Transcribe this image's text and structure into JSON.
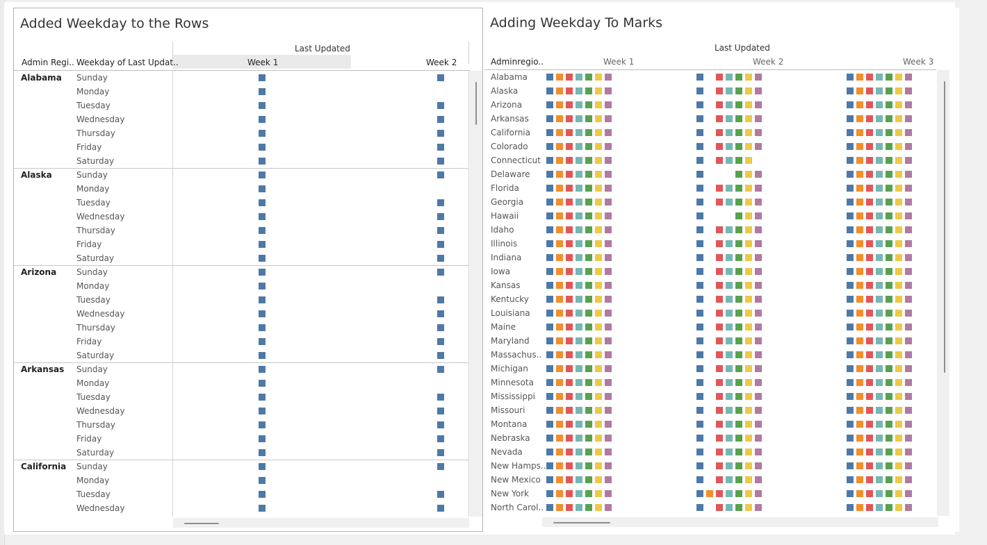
{
  "colors": {
    "Sunday": "#4e79a7",
    "Monday": "#f28e2b",
    "Tuesday": "#e15759",
    "Wednesday": "#76b7b2",
    "Thursday": "#59a14f",
    "Friday": "#edc948",
    "Saturday": "#b07aa1"
  },
  "left": {
    "title": "Added Weekday to the Rows",
    "column_group_header": "Last Updated",
    "col_headers": {
      "region": "Admin Regi..",
      "weekday": "Weekday of Last Updat.."
    },
    "weeks": [
      "Week 1",
      "Week 2"
    ],
    "states": [
      {
        "name": "Alabama",
        "days": [
          {
            "day": "Sunday",
            "w1": true,
            "w2": true
          },
          {
            "day": "Monday",
            "w1": true,
            "w2": false
          },
          {
            "day": "Tuesday",
            "w1": true,
            "w2": true
          },
          {
            "day": "Wednesday",
            "w1": true,
            "w2": true
          },
          {
            "day": "Thursday",
            "w1": true,
            "w2": true
          },
          {
            "day": "Friday",
            "w1": true,
            "w2": true
          },
          {
            "day": "Saturday",
            "w1": true,
            "w2": true
          }
        ]
      },
      {
        "name": "Alaska",
        "days": [
          {
            "day": "Sunday",
            "w1": true,
            "w2": true
          },
          {
            "day": "Monday",
            "w1": true,
            "w2": false
          },
          {
            "day": "Tuesday",
            "w1": true,
            "w2": true
          },
          {
            "day": "Wednesday",
            "w1": true,
            "w2": true
          },
          {
            "day": "Thursday",
            "w1": true,
            "w2": true
          },
          {
            "day": "Friday",
            "w1": true,
            "w2": true
          },
          {
            "day": "Saturday",
            "w1": true,
            "w2": true
          }
        ]
      },
      {
        "name": "Arizona",
        "days": [
          {
            "day": "Sunday",
            "w1": true,
            "w2": true
          },
          {
            "day": "Monday",
            "w1": true,
            "w2": false
          },
          {
            "day": "Tuesday",
            "w1": true,
            "w2": true
          },
          {
            "day": "Wednesday",
            "w1": true,
            "w2": true
          },
          {
            "day": "Thursday",
            "w1": true,
            "w2": true
          },
          {
            "day": "Friday",
            "w1": true,
            "w2": true
          },
          {
            "day": "Saturday",
            "w1": true,
            "w2": true
          }
        ]
      },
      {
        "name": "Arkansas",
        "days": [
          {
            "day": "Sunday",
            "w1": true,
            "w2": true
          },
          {
            "day": "Monday",
            "w1": true,
            "w2": false
          },
          {
            "day": "Tuesday",
            "w1": true,
            "w2": true
          },
          {
            "day": "Wednesday",
            "w1": true,
            "w2": true
          },
          {
            "day": "Thursday",
            "w1": true,
            "w2": true
          },
          {
            "day": "Friday",
            "w1": true,
            "w2": true
          },
          {
            "day": "Saturday",
            "w1": true,
            "w2": true
          }
        ]
      },
      {
        "name": "California",
        "days": [
          {
            "day": "Sunday",
            "w1": true,
            "w2": true
          },
          {
            "day": "Monday",
            "w1": true,
            "w2": false
          },
          {
            "day": "Tuesday",
            "w1": true,
            "w2": true
          },
          {
            "day": "Wednesday",
            "w1": true,
            "w2": true
          }
        ]
      }
    ]
  },
  "right": {
    "title": "Adding Weekday To Marks",
    "column_group_header": "Last Updated",
    "col_header_region": "Adminregio..",
    "weeks": [
      "Week 1",
      "Week 2",
      "Week 3"
    ],
    "states": [
      {
        "name": "Alabama",
        "w1": "SMTWRFA",
        "w2": "STWRFA",
        "w3": "SMTWRFA"
      },
      {
        "name": "Alaska",
        "w1": "SMTWRFA",
        "w2": "STWRFA",
        "w3": "SMTWRFA"
      },
      {
        "name": "Arizona",
        "w1": "SMTWRFA",
        "w2": "STWRFA",
        "w3": "SMTWRFA"
      },
      {
        "name": "Arkansas",
        "w1": "SMTWRFA",
        "w2": "STWRFA",
        "w3": "SMTWRFA"
      },
      {
        "name": "California",
        "w1": "SMTWRFA",
        "w2": "STWRFA",
        "w3": "SMTWRFA"
      },
      {
        "name": "Colorado",
        "w1": "SMTWRFA",
        "w2": "STWRFA",
        "w3": "SMTWRFA"
      },
      {
        "name": "Connecticut",
        "w1": "SMTWRFA",
        "w2": "STWRF",
        "w3": "SMTWRFA"
      },
      {
        "name": "Delaware",
        "w1": "SMTWRFA",
        "w2": "SRFA",
        "w3": "SMTWRFA"
      },
      {
        "name": "Florida",
        "w1": "SMTWRFA",
        "w2": "STWRFA",
        "w3": "SMTWRFA"
      },
      {
        "name": "Georgia",
        "w1": "SMTWRFA",
        "w2": "STWRFA",
        "w3": "SMTWRFA"
      },
      {
        "name": "Hawaii",
        "w1": "SMTWRFA",
        "w2": "SRFA",
        "w3": "SMTWRFA"
      },
      {
        "name": "Idaho",
        "w1": "SMTWRFA",
        "w2": "STWRFA",
        "w3": "SMTWRFA"
      },
      {
        "name": "Illinois",
        "w1": "SMTWRFA",
        "w2": "STWRFA",
        "w3": "SMTWRFA"
      },
      {
        "name": "Indiana",
        "w1": "SMTWRFA",
        "w2": "STWRFA",
        "w3": "SMTWRFA"
      },
      {
        "name": "Iowa",
        "w1": "SMTWRFA",
        "w2": "STWRFA",
        "w3": "SMTWRFA"
      },
      {
        "name": "Kansas",
        "w1": "SMTWRFA",
        "w2": "STWRFA",
        "w3": "SMTWRFA"
      },
      {
        "name": "Kentucky",
        "w1": "SMTWRFA",
        "w2": "STWRFA",
        "w3": "SMTWRFA"
      },
      {
        "name": "Louisiana",
        "w1": "SMTWRFA",
        "w2": "STWRFA",
        "w3": "SMTWRFA"
      },
      {
        "name": "Maine",
        "w1": "SMTWRFA",
        "w2": "STWRFA",
        "w3": "SMTWRFA"
      },
      {
        "name": "Maryland",
        "w1": "SMTWRFA",
        "w2": "STWRFA",
        "w3": "SMTWRFA"
      },
      {
        "name": "Massachus..",
        "w1": "SMTWRFA",
        "w2": "STWRFA",
        "w3": "SMTWRFA"
      },
      {
        "name": "Michigan",
        "w1": "SMTWRFA",
        "w2": "STWRFA",
        "w3": "SMTWRFA"
      },
      {
        "name": "Minnesota",
        "w1": "SMTWRFA",
        "w2": "STWRFA",
        "w3": "SMTWRFA"
      },
      {
        "name": "Mississippi",
        "w1": "SMTWRFA",
        "w2": "STWRFA",
        "w3": "SMTWRFA"
      },
      {
        "name": "Missouri",
        "w1": "SMTWRFA",
        "w2": "STWRFA",
        "w3": "SMTWRFA"
      },
      {
        "name": "Montana",
        "w1": "SMTWRFA",
        "w2": "STWRFA",
        "w3": "SMTWRFA"
      },
      {
        "name": "Nebraska",
        "w1": "SMTWRFA",
        "w2": "STWRFA",
        "w3": "SMTWRFA"
      },
      {
        "name": "Nevada",
        "w1": "SMTWRFA",
        "w2": "STWRFA",
        "w3": "SMTWRFA"
      },
      {
        "name": "New Hamps..",
        "w1": "SMTWRFA",
        "w2": "STWRFA",
        "w3": "SMTWRFA"
      },
      {
        "name": "New Mexico",
        "w1": "SMTWRFA",
        "w2": "STWRFA",
        "w3": "SMTWRFA"
      },
      {
        "name": "New York",
        "w1": "SMTWRFA",
        "w2": "SMTWRFA",
        "w3": "SMTWRFA"
      },
      {
        "name": "North Carol..",
        "w1": "SMTWRFA",
        "w2": "STWRFA",
        "w3": "SMTWRFA"
      }
    ]
  }
}
